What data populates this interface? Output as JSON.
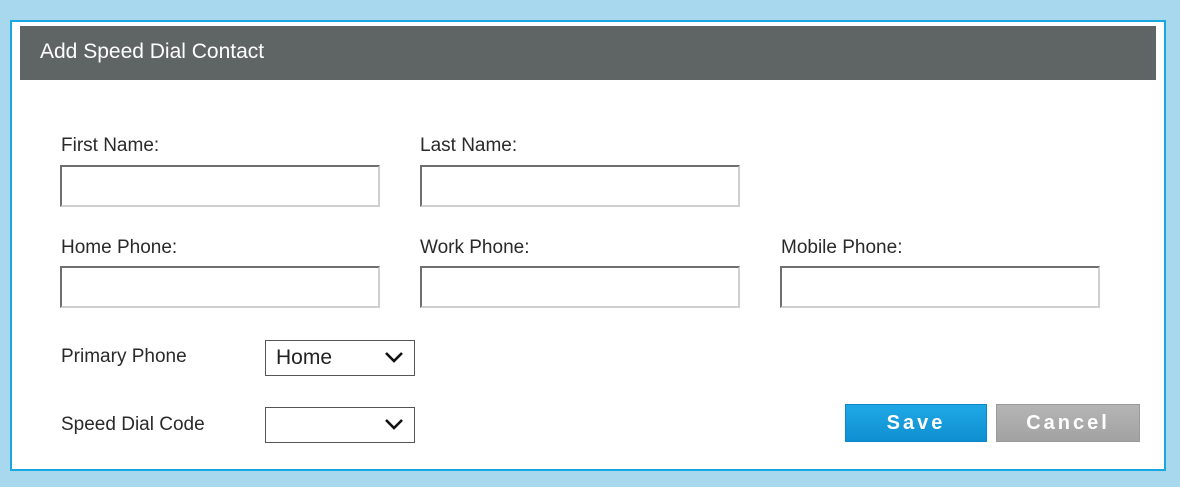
{
  "dialog": {
    "title": "Add Speed Dial Contact"
  },
  "form": {
    "first_name": {
      "label": "First Name:",
      "value": ""
    },
    "last_name": {
      "label": "Last Name:",
      "value": ""
    },
    "home_phone": {
      "label": "Home Phone:",
      "value": ""
    },
    "work_phone": {
      "label": "Work Phone:",
      "value": ""
    },
    "mobile_phone": {
      "label": "Mobile Phone:",
      "value": ""
    },
    "primary_phone": {
      "label": "Primary Phone",
      "selected": "Home"
    },
    "speed_dial_code": {
      "label": "Speed Dial Code",
      "selected": ""
    }
  },
  "buttons": {
    "save": "Save",
    "cancel": "Cancel"
  },
  "colors": {
    "page_background": "#a8d8ee",
    "dialog_border": "#1aa6e0",
    "title_bar": "#5f6465",
    "save_button": "#1aa0e0",
    "cancel_button": "#a9a9a9"
  },
  "icons": {
    "dropdown": "chevron-down-icon"
  }
}
